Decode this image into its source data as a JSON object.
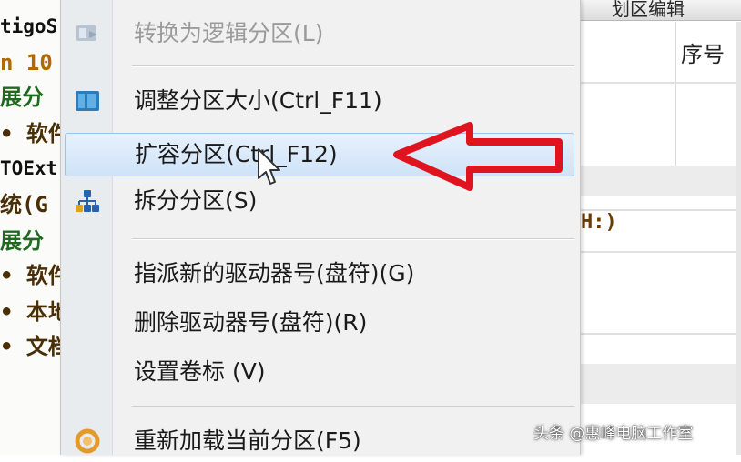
{
  "background_tree": {
    "lines": [
      "tigoS",
      "n 10",
      "展分",
      "• 软件",
      "TOExt",
      "统(G",
      "展分",
      "• 软件",
      "• 本地",
      "• 文档"
    ]
  },
  "background_grid": {
    "header_cell": "划区编辑",
    "column_header": "序号",
    "drive_text": "H:)"
  },
  "context_menu": {
    "items": [
      {
        "label": "转换为逻辑分区(L)",
        "icon": "convert-partition-icon",
        "state": "disabled"
      },
      {
        "label": "调整分区大小(Ctrl_F11)",
        "icon": "resize-partition-icon",
        "state": "normal"
      },
      {
        "label": "扩容分区(Ctrl_F12)",
        "icon": "",
        "state": "highlighted"
      },
      {
        "label": "拆分分区(S)",
        "icon": "split-partition-icon",
        "state": "normal"
      },
      {
        "label": "指派新的驱动器号(盘符)(G)",
        "icon": "",
        "state": "normal"
      },
      {
        "label": "删除驱动器号(盘符)(R)",
        "icon": "",
        "state": "normal"
      },
      {
        "label": "设置卷标 (V)",
        "icon": "",
        "state": "normal"
      },
      {
        "label": "重新加载当前分区(F5)",
        "icon": "reload-icon",
        "state": "normal"
      }
    ]
  },
  "annotation": {
    "arrow_color": "#e0141e"
  },
  "watermark": {
    "text": "头条 @惠峰电脑工作室"
  },
  "colors": {
    "menu_bg": "#f1f1f1",
    "highlight": "#cfe3f8",
    "arrow": "#e0141e"
  }
}
